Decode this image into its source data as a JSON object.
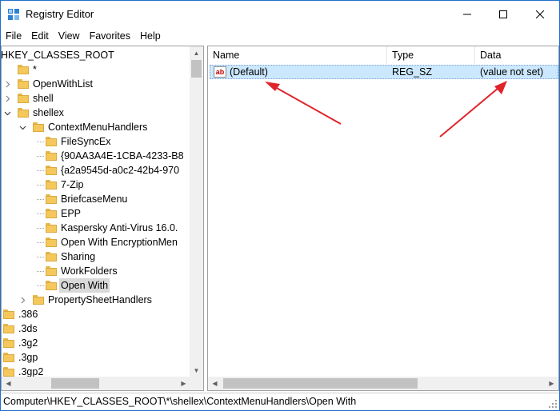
{
  "window": {
    "title": "Registry Editor"
  },
  "menu": [
    "File",
    "Edit",
    "View",
    "Favorites",
    "Help"
  ],
  "tree": [
    {
      "label": "HKEY_CLASSES_ROOT",
      "level": -1,
      "expander": "none",
      "folder": false,
      "selected": false
    },
    {
      "label": "*",
      "level": 0,
      "expander": "none",
      "folder": true,
      "selected": false
    },
    {
      "label": "OpenWithList",
      "level": 0,
      "expander": "collapsed",
      "folder": true,
      "selected": false
    },
    {
      "label": "shell",
      "level": 0,
      "expander": "collapsed",
      "folder": true,
      "selected": false
    },
    {
      "label": "shellex",
      "level": 0,
      "expander": "expanded",
      "folder": true,
      "selected": false
    },
    {
      "label": "ContextMenuHandlers",
      "level": 1,
      "expander": "expanded",
      "folder": true,
      "selected": false
    },
    {
      "label": " FileSyncEx",
      "level": 2,
      "expander": "none",
      "folder": true,
      "selected": false
    },
    {
      "label": "{90AA3A4E-1CBA-4233-B8",
      "level": 2,
      "expander": "none",
      "folder": true,
      "selected": false
    },
    {
      "label": "{a2a9545d-a0c2-42b4-970",
      "level": 2,
      "expander": "none",
      "folder": true,
      "selected": false
    },
    {
      "label": "7-Zip",
      "level": 2,
      "expander": "none",
      "folder": true,
      "selected": false
    },
    {
      "label": "BriefcaseMenu",
      "level": 2,
      "expander": "none",
      "folder": true,
      "selected": false
    },
    {
      "label": "EPP",
      "level": 2,
      "expander": "none",
      "folder": true,
      "selected": false
    },
    {
      "label": "Kaspersky Anti-Virus 16.0.",
      "level": 2,
      "expander": "none",
      "folder": true,
      "selected": false
    },
    {
      "label": "Open With EncryptionMen",
      "level": 2,
      "expander": "none",
      "folder": true,
      "selected": false
    },
    {
      "label": "Sharing",
      "level": 2,
      "expander": "none",
      "folder": true,
      "selected": false
    },
    {
      "label": "WorkFolders",
      "level": 2,
      "expander": "none",
      "folder": true,
      "selected": false
    },
    {
      "label": "Open With",
      "level": 2,
      "expander": "none",
      "folder": true,
      "selected": true
    },
    {
      "label": "PropertySheetHandlers",
      "level": 1,
      "expander": "collapsed",
      "folder": true,
      "selected": false
    },
    {
      "label": ".386",
      "level": -1,
      "expander": "none",
      "folder": true,
      "selected": false
    },
    {
      "label": ".3ds",
      "level": -1,
      "expander": "none",
      "folder": true,
      "selected": false
    },
    {
      "label": ".3g2",
      "level": -1,
      "expander": "none",
      "folder": true,
      "selected": false
    },
    {
      "label": ".3gp",
      "level": -1,
      "expander": "none",
      "folder": true,
      "selected": false
    },
    {
      "label": ".3gp2",
      "level": -1,
      "expander": "none",
      "folder": true,
      "selected": false
    }
  ],
  "list": {
    "columns": [
      "Name",
      "Type",
      "Data"
    ],
    "rows": [
      {
        "icon": "string-value-icon",
        "icon_text": "ab",
        "name": "(Default)",
        "type": "REG_SZ",
        "data": "(value not set)"
      }
    ]
  },
  "annotations": {
    "arrow_color": "#e0242c"
  },
  "status": {
    "path": "Computer\\HKEY_CLASSES_ROOT\\*\\shellex\\ContextMenuHandlers\\Open With"
  },
  "colors": {
    "accent": "#1e6fcc",
    "selection": "#cce8ff",
    "tree_selection": "#d9d9d9",
    "folder": "#f4c85b"
  }
}
